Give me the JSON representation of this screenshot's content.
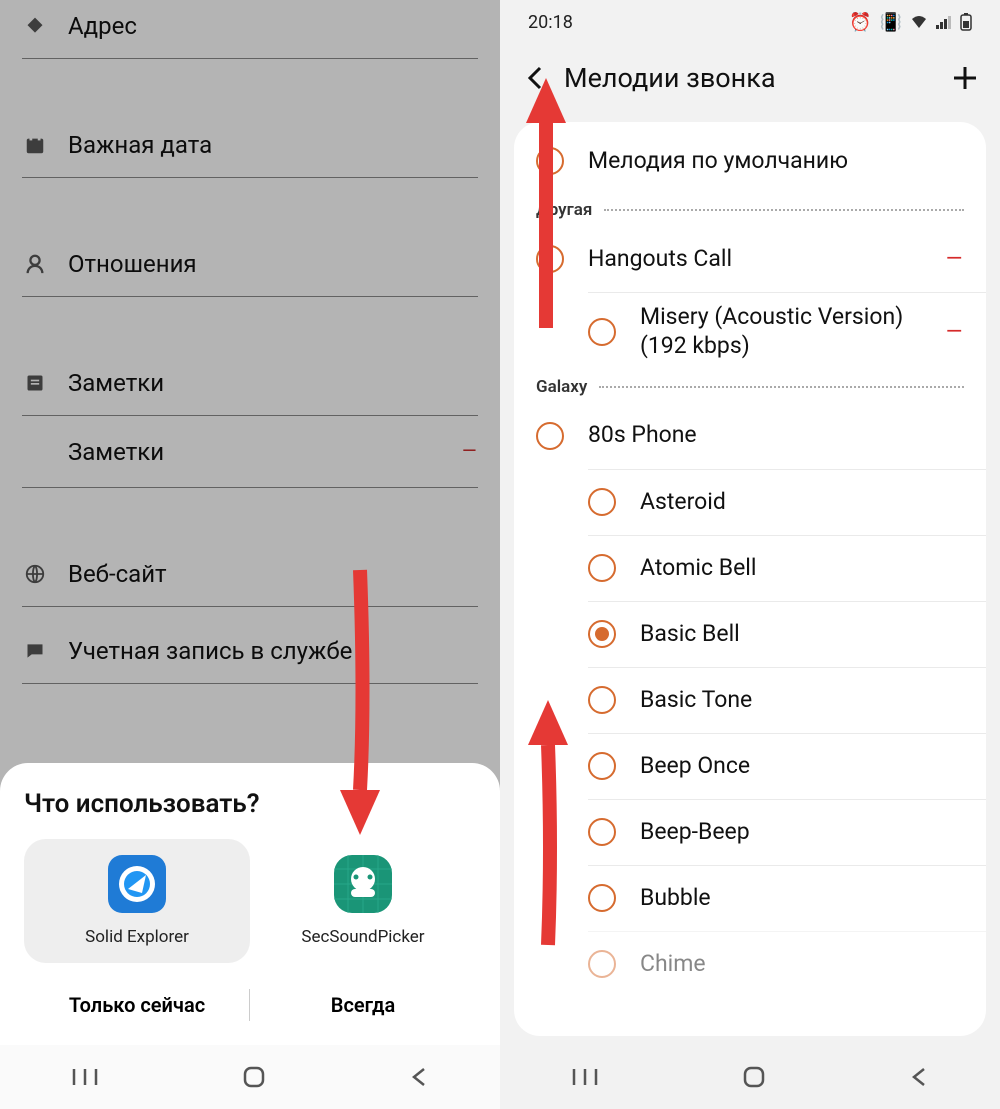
{
  "left": {
    "fields": {
      "address": "Адрес",
      "date": "Важная дата",
      "relation": "Отношения",
      "notes_header": "Заметки",
      "notes_row": "Заметки",
      "website": "Веб-сайт",
      "account": "Учетная запись в службе"
    },
    "sheet": {
      "title": "Что использовать?",
      "apps": {
        "solid": "Solid Explorer",
        "sec": "SecSoundPicker"
      },
      "once": "Только сейчас",
      "always": "Всегда"
    }
  },
  "right": {
    "status_time": "20:18",
    "appbar_title": "Мелодии звонка",
    "rows": {
      "default": "Мелодия по умолчанию",
      "group_other": "Другая",
      "hangouts": "Hangouts Call",
      "misery": "Misery (Acoustic Version) (192  kbps)",
      "group_galaxy": "Galaxy",
      "r80s": "80s Phone",
      "asteroid": "Asteroid",
      "atomic": "Atomic Bell",
      "basic_bell": "Basic Bell",
      "basic_tone": "Basic Tone",
      "beep_once": "Beep Once",
      "beep_beep": "Beep-Beep",
      "bubble": "Bubble",
      "chime": "Chime"
    }
  }
}
